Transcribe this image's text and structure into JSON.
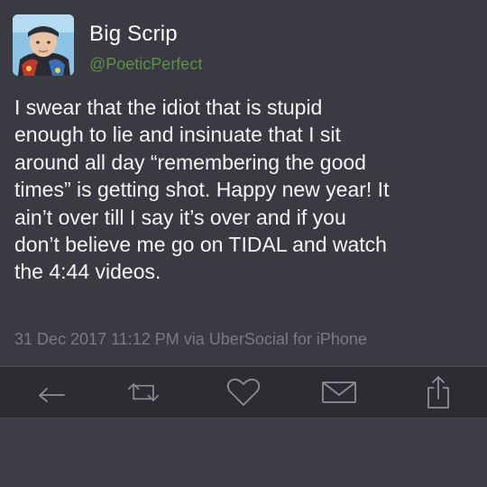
{
  "tweet": {
    "display_name": "Big Scrip",
    "handle": "@PoeticPerfect",
    "text": "I swear that the idiot that is stupid\nenough to lie and insinuate that I sit\naround all day “remembering the good\ntimes” is getting shot. Happy new year! It\nain’t over till I say it’s over and if you\ndon’t believe me go on TIDAL and watch\nthe 4:44 videos.",
    "timestamp_line": "31 Dec 2017 11:12 PM via UberSocial for iPhone"
  },
  "actions": [
    {
      "icon": "reply-icon",
      "name": "reply-button"
    },
    {
      "icon": "retweet-icon",
      "name": "retweet-button"
    },
    {
      "icon": "heart-icon",
      "name": "like-button"
    },
    {
      "icon": "mail-icon",
      "name": "message-button"
    },
    {
      "icon": "share-icon",
      "name": "share-button"
    }
  ],
  "colors": {
    "background": "#3d3d45",
    "text": "#f4f4f4",
    "handle": "#5e8f43",
    "meta": "#7a7a84",
    "action_bar": "#2c2c33",
    "icon": "#8e8e96"
  }
}
